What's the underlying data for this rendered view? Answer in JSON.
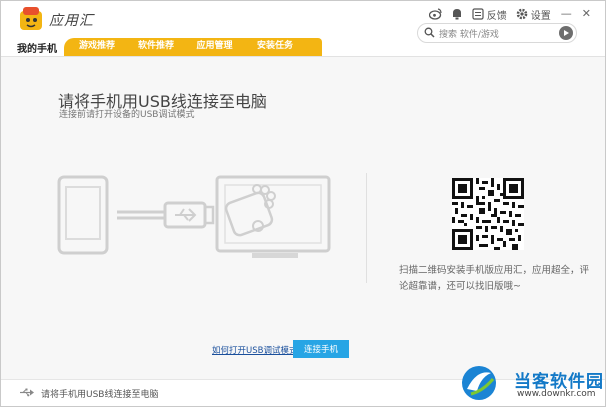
{
  "app": {
    "title": "应用汇"
  },
  "titlebar": {
    "feedback_label": "反馈",
    "settings_label": "设置",
    "minimize": "—",
    "close": "✕"
  },
  "search": {
    "placeholder": "搜索 软件/游戏"
  },
  "tabs": {
    "mine": "我的手机",
    "items": [
      {
        "label": "游戏推荐"
      },
      {
        "label": "软件推荐"
      },
      {
        "label": "应用管理"
      },
      {
        "label": "安装任务"
      }
    ]
  },
  "main": {
    "headline": "请将手机用USB线连接至电脑",
    "subline": "连接前请打开设备的USB调试模式",
    "qr_text": "扫描二维码安装手机版应用汇，应用超全，评论超靠谱，还可以找旧版哦~",
    "help_link": "如何打开USB调试模式？",
    "connect_button": "连接手机"
  },
  "statusbar": {
    "text": "请将手机用USB线连接至电脑"
  },
  "watermark": {
    "title": "当客软件园",
    "url": "www.downkr.com"
  },
  "colors": {
    "accent": "#f3b513",
    "button": "#27a5e5",
    "link": "#1a4f9c",
    "brand": "#1379c7"
  },
  "icons": [
    "app-logo-icon",
    "weibo-icon",
    "bell-icon",
    "feedback-icon",
    "gear-icon",
    "search-icon",
    "usb-icon"
  ]
}
